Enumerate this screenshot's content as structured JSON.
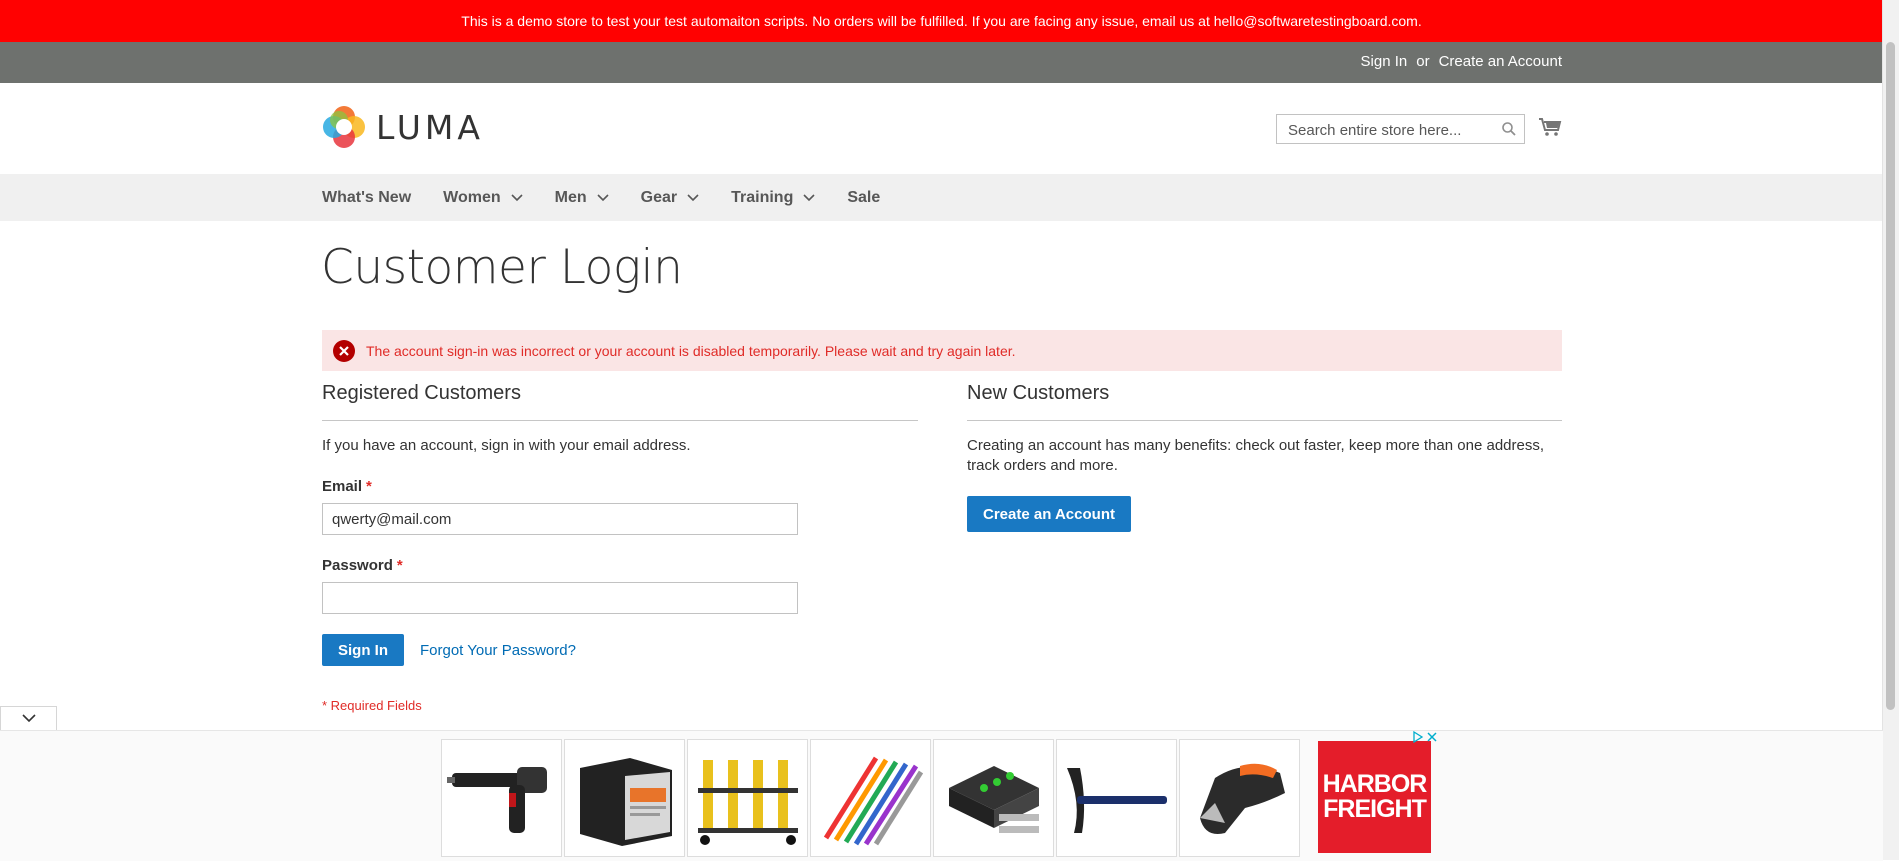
{
  "notice": {
    "text": "This is a demo store to test your test automaiton scripts. No orders will be fulfilled. If you are facing any issue, email us at hello@softwaretestingboard.com."
  },
  "topbar": {
    "signin": "Sign In",
    "or": "or",
    "create_account": "Create an Account"
  },
  "header": {
    "logo_text": "LUMA",
    "search_placeholder": "Search entire store here..."
  },
  "nav": {
    "items": [
      {
        "label": "What's New",
        "dropdown": false
      },
      {
        "label": "Women",
        "dropdown": true
      },
      {
        "label": "Men",
        "dropdown": true
      },
      {
        "label": "Gear",
        "dropdown": true
      },
      {
        "label": "Training",
        "dropdown": true
      },
      {
        "label": "Sale",
        "dropdown": false
      }
    ]
  },
  "page": {
    "title": "Customer Login",
    "error": "The account sign-in was incorrect or your account is disabled temporarily. Please wait and try again later."
  },
  "registered": {
    "title": "Registered Customers",
    "intro": "If you have an account, sign in with your email address.",
    "email_label": "Email",
    "email_value": "qwerty@mail.com",
    "password_label": "Password",
    "password_value": "",
    "required_star": "*",
    "signin_button": "Sign In",
    "forgot_link": "Forgot Your Password?",
    "required_note": "* Required Fields"
  },
  "new_customers": {
    "title": "New Customers",
    "text": "Creating an account has many benefits: check out faster, keep more than one address, track orders and more.",
    "button": "Create an Account"
  },
  "ad": {
    "brand_line1": "HARBOR",
    "brand_line2": "FREIGHT",
    "products": [
      "air-hammer",
      "battery",
      "wheel-dollies",
      "punch-set",
      "trailer-connector",
      "pick-mattock",
      "power-shears"
    ]
  },
  "colors": {
    "notice_bg": "#ff0101",
    "topbar_bg": "#6e716e",
    "primary": "#1979c3",
    "error_text": "#e02b27",
    "error_bg": "#fae5e5"
  }
}
